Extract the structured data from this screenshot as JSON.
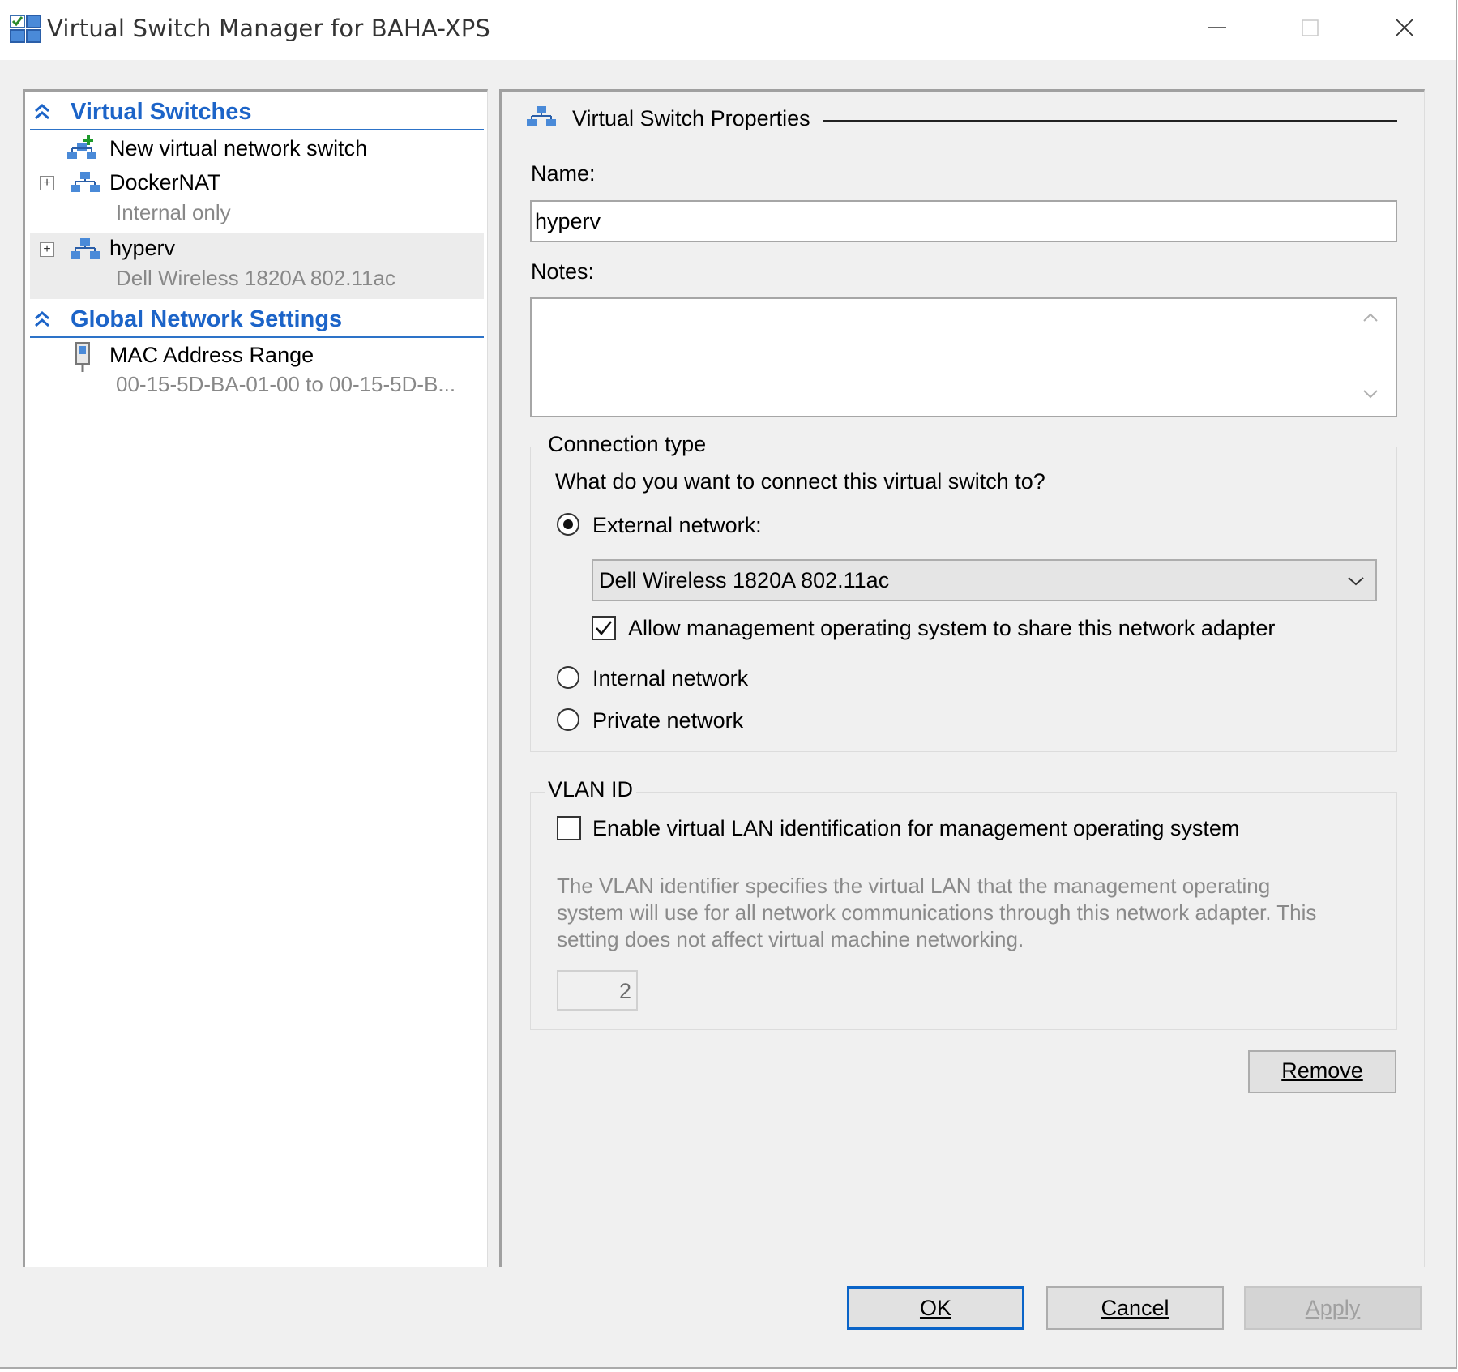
{
  "window": {
    "title": "Virtual Switch Manager for BAHA-XPS"
  },
  "left_pane": {
    "virtual_switches_header": "Virtual Switches",
    "new_switch_label": "New virtual network switch",
    "switches": [
      {
        "name": "DockerNAT",
        "detail": "Internal only"
      },
      {
        "name": "hyperv",
        "detail": "Dell Wireless 1820A 802.11ac"
      }
    ],
    "global_settings_header": "Global Network Settings",
    "mac_range": {
      "name": "MAC Address Range",
      "detail": "00-15-5D-BA-01-00 to 00-15-5D-B..."
    }
  },
  "properties": {
    "header": "Virtual Switch Properties",
    "name_label": "Name:",
    "name_value": "hyperv",
    "notes_label": "Notes:",
    "notes_value": "",
    "connection_type": {
      "title": "Connection type",
      "question": "What do you want to connect this virtual switch to?",
      "external_label": "External network:",
      "external_selected": true,
      "adapter_value": "Dell Wireless 1820A 802.11ac",
      "allow_mgmt_label": "Allow management operating system to share this network adapter",
      "allow_mgmt_checked": true,
      "internal_label": "Internal network",
      "private_label": "Private network"
    },
    "vlan": {
      "title": "VLAN ID",
      "enable_label": "Enable virtual LAN identification for management operating system",
      "enable_checked": false,
      "description_line1": "The VLAN identifier specifies the virtual LAN that the management operating",
      "description_line2": "system will use for all network communications through this network adapter. This",
      "description_line3": "setting does not affect virtual machine networking.",
      "value": "2"
    },
    "remove_label": "Remove"
  },
  "footer": {
    "ok_label": "OK",
    "cancel_label": "Cancel",
    "apply_label": "Apply"
  },
  "colors": {
    "accent": "#1c64c8",
    "window_bg": "#f0f0f0",
    "disabled_text": "#a0a0a0"
  }
}
